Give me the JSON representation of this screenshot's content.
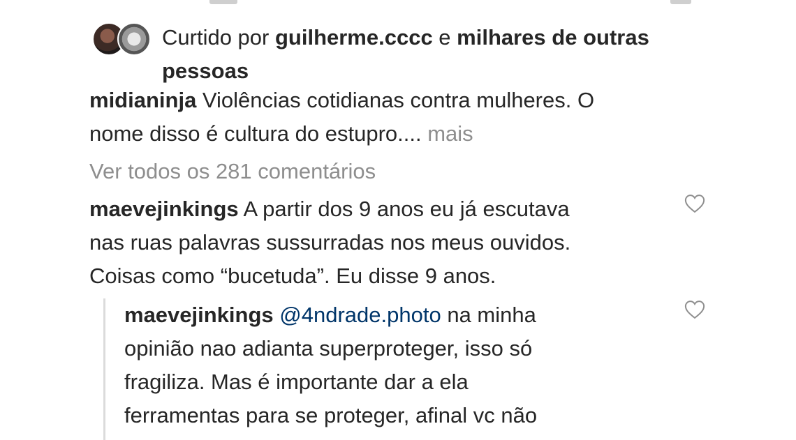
{
  "likes": {
    "prefix": "Curtido por ",
    "user": "guilherme.cccc",
    "connector": " e ",
    "others_line1": "milhares de outras",
    "others_line2": "pessoas"
  },
  "caption": {
    "username": "midianinja",
    "text_line1": " Violências cotidianas contra mulheres. O",
    "text_line2": "nome disso é cultura do estupro.... ",
    "more": "mais"
  },
  "view_all_comments": "Ver todos os 281 comentários",
  "comments": [
    {
      "username": "maevejinkings",
      "line1": " A partir dos 9 anos eu já escutava",
      "line2": "nas ruas palavras sussurradas nos meus ouvidos.",
      "line3": "Coisas como “bucetuda”. Eu disse 9 anos."
    },
    {
      "username": "maevejinkings",
      "mention": "@4ndrade.photo",
      "line1_rest": " na minha",
      "line2": "opinião nao adianta superproteger, isso só",
      "line3": "fragiliza. Mas é importante dar a ela",
      "line4": "ferramentas para se proteger, afinal vc não"
    }
  ],
  "icons": {
    "like": "heart-outline-icon"
  },
  "colors": {
    "text": "#262626",
    "muted": "#8e8e8e",
    "mention": "#003569",
    "reply_bar": "#dbdbdb",
    "background": "#ffffff"
  }
}
